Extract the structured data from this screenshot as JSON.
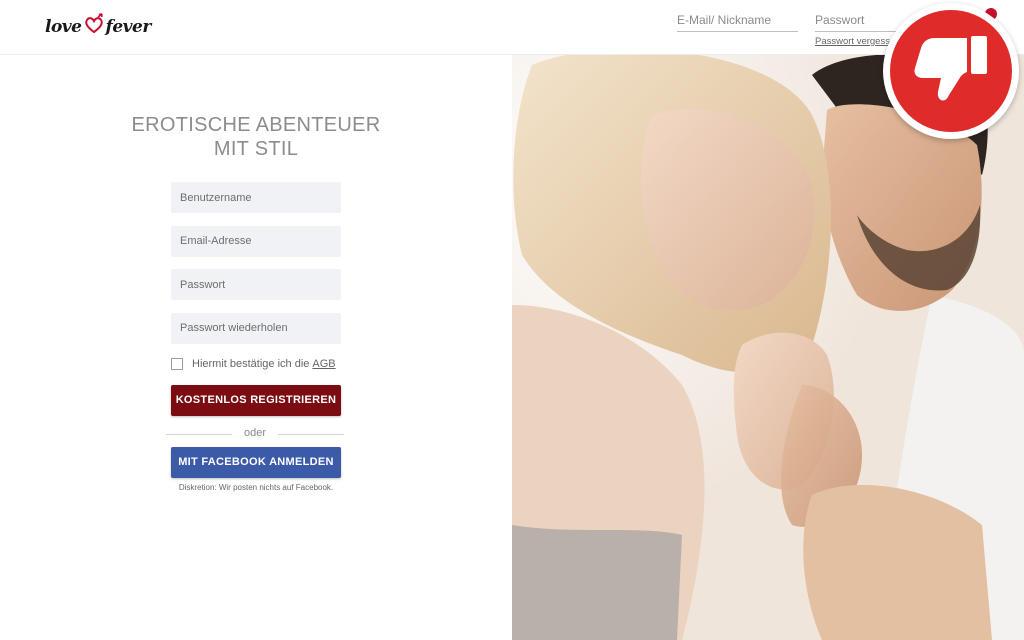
{
  "header": {
    "logo_text_left": "love",
    "logo_text_right": "fever",
    "email_placeholder": "E-Mail/ Nickname",
    "password_placeholder": "Passwort",
    "forgot_password": "Passwort vergessen?"
  },
  "hero": {
    "headline_line1": "EROTISCHE ABENTEUER",
    "headline_line2": "MIT STIL"
  },
  "form": {
    "username_placeholder": "Benutzername",
    "email_placeholder": "Email-Adresse",
    "password_placeholder": "Passwort",
    "password_repeat_placeholder": "Passwort wiederholen",
    "agb_text": "Hiermit bestätige ich die",
    "agb_link": "AGB",
    "register_button": "KOSTENLOS REGISTRIEREN",
    "or_text": "oder",
    "facebook_button": "MIT FACEBOOK ANMELDEN",
    "disclaimer": "Diskretion: Wir posten nichts auf Facebook."
  },
  "badge": {
    "icon": "thumbs-down-icon"
  },
  "colors": {
    "brand_red": "#c8102e",
    "register_button": "#7a0c12",
    "facebook_button": "#3b5aa7",
    "badge_red": "#e02b2b",
    "input_background": "#f1f2f6"
  }
}
